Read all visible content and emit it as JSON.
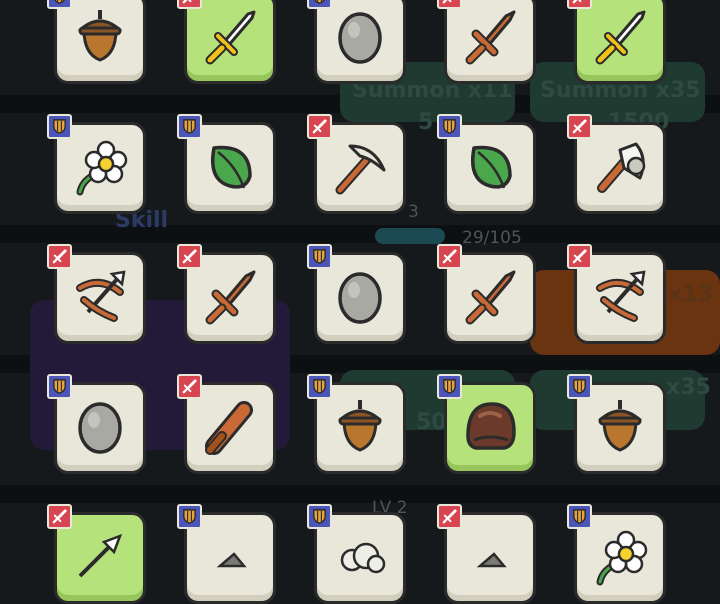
{
  "background": {
    "texts": [
      {
        "key": "summon_x11",
        "text": "Summon x11"
      },
      {
        "key": "summon_x35_top",
        "text": "Summon x35"
      },
      {
        "key": "cost_left",
        "text": "5"
      },
      {
        "key": "cost_right",
        "text": "1500"
      },
      {
        "key": "skill_label",
        "text": "Skill"
      },
      {
        "key": "skill_level",
        "text": "3"
      },
      {
        "key": "progress",
        "text": "29/105"
      },
      {
        "key": "summon_x13",
        "text": "x13"
      },
      {
        "key": "summon_x35_mid",
        "text": "x35"
      },
      {
        "key": "cost_mid",
        "text": "50"
      },
      {
        "key": "level_bottom",
        "text": "LV 2"
      }
    ]
  },
  "colors": {
    "slot": "#e9e7da",
    "slot_highlight": "#b6e27c",
    "badge_shield": "#4c55b8",
    "badge_sword": "#d64550",
    "wood": "#c96a36",
    "acorn": "#b9762f",
    "stone": "#a9a9a3",
    "leaf": "#4aa74c"
  },
  "inventory": [
    {
      "badge": "shield",
      "item": "acorn",
      "highlight": false
    },
    {
      "badge": "sword",
      "item": "dagger",
      "highlight": true
    },
    {
      "badge": "shield",
      "item": "stone",
      "highlight": false
    },
    {
      "badge": "sword",
      "item": "wooden-sword",
      "highlight": false
    },
    {
      "badge": "sword",
      "item": "dagger",
      "highlight": true
    },
    {
      "badge": "shield",
      "item": "flower",
      "highlight": false
    },
    {
      "badge": "shield",
      "item": "leaf",
      "highlight": false
    },
    {
      "badge": "sword",
      "item": "pickaxe",
      "highlight": false
    },
    {
      "badge": "shield",
      "item": "leaf",
      "highlight": false
    },
    {
      "badge": "sword",
      "item": "axe",
      "highlight": false
    },
    {
      "badge": "sword",
      "item": "crossbow",
      "highlight": false
    },
    {
      "badge": "sword",
      "item": "wooden-sword",
      "highlight": false
    },
    {
      "badge": "shield",
      "item": "stone",
      "highlight": false
    },
    {
      "badge": "sword",
      "item": "wooden-sword",
      "highlight": false
    },
    {
      "badge": "sword",
      "item": "crossbow",
      "highlight": false
    },
    {
      "badge": "shield",
      "item": "stone",
      "highlight": false
    },
    {
      "badge": "sword",
      "item": "club",
      "highlight": false
    },
    {
      "badge": "shield",
      "item": "acorn",
      "highlight": false
    },
    {
      "badge": "shield",
      "item": "helmet",
      "highlight": true
    },
    {
      "badge": "shield",
      "item": "acorn",
      "highlight": false
    },
    {
      "badge": "sword",
      "item": "arrow",
      "highlight": true
    },
    {
      "badge": "shield",
      "item": "unknown",
      "highlight": false
    },
    {
      "badge": "shield",
      "item": "cloud",
      "highlight": false
    },
    {
      "badge": "sword",
      "item": "unknown",
      "highlight": false
    },
    {
      "badge": "shield",
      "item": "flower",
      "highlight": false
    }
  ]
}
